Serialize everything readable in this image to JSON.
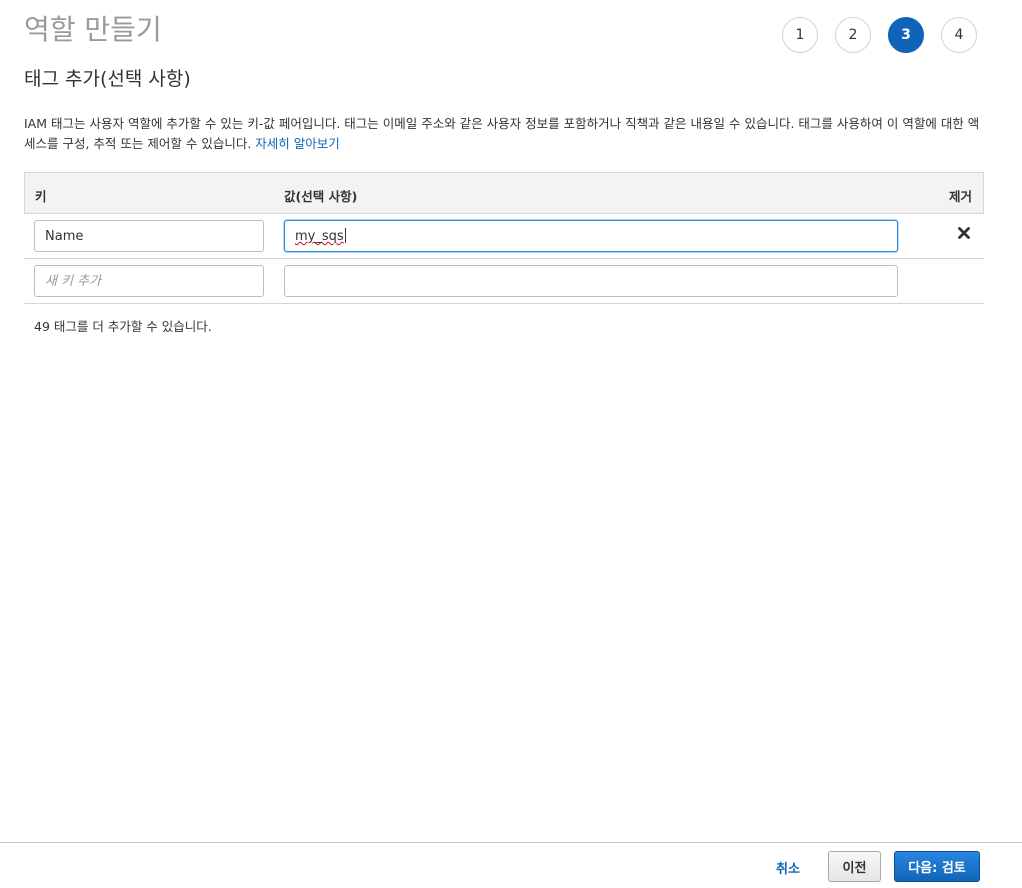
{
  "page": {
    "title": "역할 만들기",
    "steps": [
      "1",
      "2",
      "3",
      "4"
    ],
    "active_step": "3"
  },
  "section": {
    "title": "태그 추가(선택 사항)",
    "description": "IAM 태그는 사용자 역할에 추가할 수 있는 키-값 페어입니다. 태그는 이메일 주소와 같은 사용자 정보를 포함하거나 직책과 같은 내용일 수 있습니다. 태그를 사용하여 이 역할에 대한 액세스를 구성, 추적 또는 제어할 수 있습니다.",
    "learn_more": "자세히 알아보기"
  },
  "tag_table": {
    "headers": {
      "key": "키",
      "value": "값(선택 사항)",
      "remove": "제거"
    },
    "rows": [
      {
        "key": "Name",
        "value": "my_sqs"
      }
    ],
    "new_key_placeholder": "새 키 추가",
    "new_value": ""
  },
  "tags_remaining": "49 태그를 더 추가할 수 있습니다.",
  "footer": {
    "cancel": "취소",
    "previous": "이전",
    "next": "다음: 검토"
  },
  "colors": {
    "primary": "#0f64b9",
    "title_gray": "#9a9a9a",
    "focus_border": "#2e8ddd"
  },
  "icons": {
    "remove": "close-icon"
  }
}
